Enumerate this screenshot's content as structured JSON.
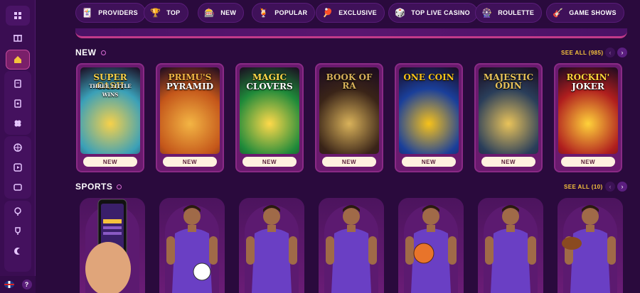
{
  "nav": {
    "items": [
      {
        "label": "PROVIDERS",
        "icon": "providers-icon",
        "glyph": "🃏"
      },
      {
        "label": "TOP",
        "icon": "trophy-icon",
        "glyph": "🏆"
      },
      {
        "label": "NEW",
        "icon": "new-icon",
        "glyph": "🎰"
      },
      {
        "label": "POPULAR",
        "icon": "popular-icon",
        "glyph": "🍹"
      },
      {
        "label": "EXCLUSIVE",
        "icon": "exclusive-icon",
        "glyph": "🏓"
      },
      {
        "label": "TOP LIVE CASINO",
        "icon": "live-casino-icon",
        "glyph": "🎲"
      },
      {
        "label": "ROULETTE",
        "icon": "roulette-icon",
        "glyph": "🎡"
      },
      {
        "label": "GAME SHOWS",
        "icon": "game-shows-icon",
        "glyph": "🎸"
      }
    ]
  },
  "new_section": {
    "title": "NEW",
    "see_all": "SEE ALL (985)",
    "games": [
      {
        "title": "SUPER CASH",
        "subtitle": "THREE LITTLE WINS",
        "badge": "NEW",
        "bg": "#3aa0b8",
        "accent": "#f7d14a"
      },
      {
        "title": "PRIMU'S",
        "subtitle": "PYRAMID",
        "badge": "NEW",
        "bg": "#c4561a",
        "accent": "#f3b544"
      },
      {
        "title": "MAGIC",
        "subtitle": "CLOVERS",
        "badge": "NEW",
        "bg": "#1f8a3a",
        "accent": "#ffd94a"
      },
      {
        "title": "BOOK OF RA",
        "subtitle": "",
        "badge": "NEW",
        "bg": "#3a2418",
        "accent": "#d9b25a"
      },
      {
        "title": "ONE COIN",
        "subtitle": "",
        "badge": "NEW",
        "bg": "#1a3f9a",
        "accent": "#f7c21a"
      },
      {
        "title": "MAJESTIC ODIN",
        "subtitle": "",
        "badge": "NEW",
        "bg": "#2a3e5a",
        "accent": "#e9c35a"
      },
      {
        "title": "ROCKIN'",
        "subtitle": "JOKER",
        "badge": "NEW",
        "bg": "#b01e1e",
        "accent": "#ffd23a"
      }
    ]
  },
  "sports_section": {
    "title": "SPORTS",
    "see_all": "SEE ALL (10)",
    "cards": [
      {
        "icon": "phone-betting-icon"
      },
      {
        "icon": "football-player-icon"
      },
      {
        "icon": "tennis-player-icon"
      },
      {
        "icon": "table-tennis-player-icon"
      },
      {
        "icon": "basketball-player-icon"
      },
      {
        "icon": "hockey-player-icon"
      },
      {
        "icon": "american-football-player-icon"
      }
    ]
  },
  "colors": {
    "accent": "#f5c23c",
    "card_border": "#8a2a86",
    "background": "#2a0a3d"
  }
}
